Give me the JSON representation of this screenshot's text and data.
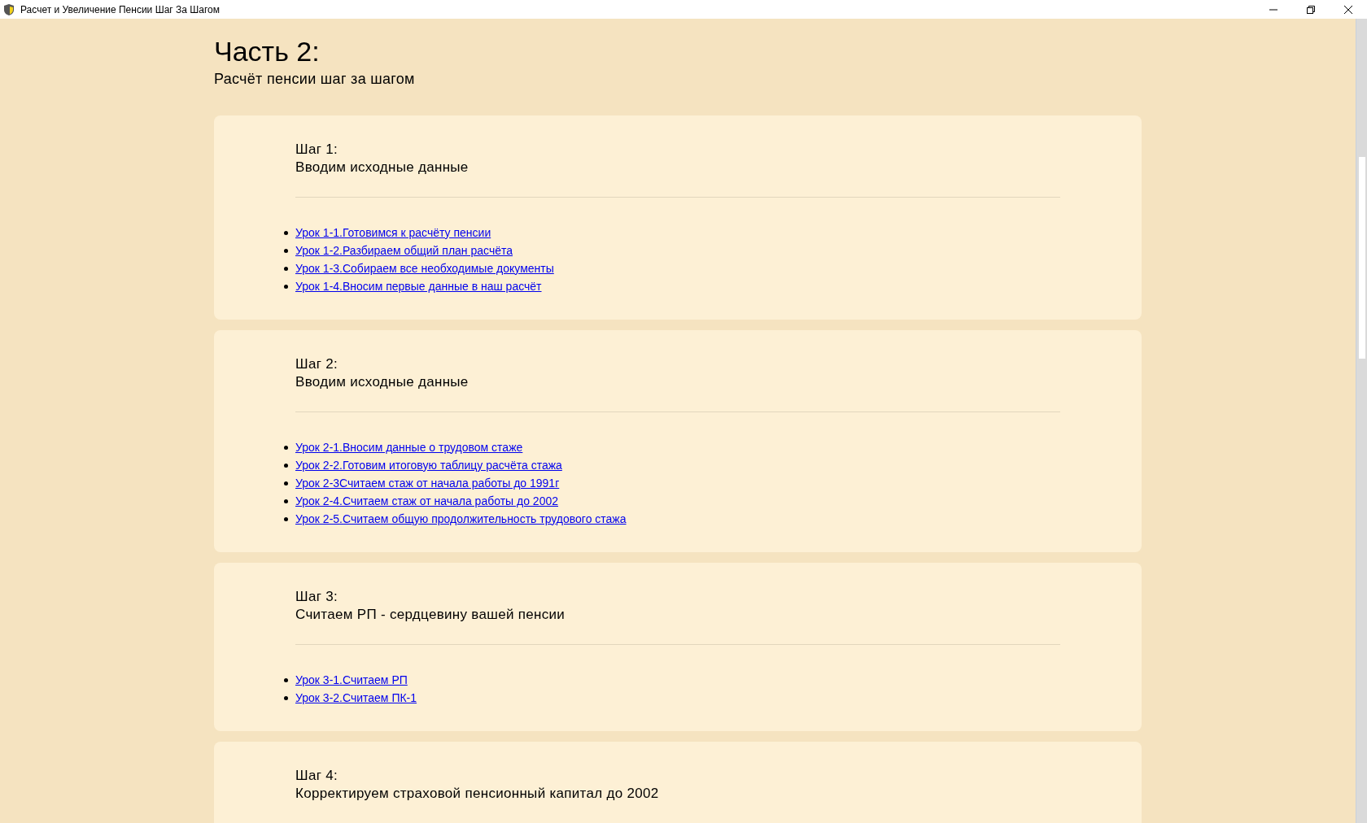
{
  "window": {
    "title": "Расчет и Увеличение Пенсии Шаг За Шагом"
  },
  "part": {
    "heading": "Часть 2:",
    "subtitle": "Расчёт пенсии шаг за шагом"
  },
  "steps": [
    {
      "label": "Шаг 1:",
      "title": "Вводим исходные данные",
      "lessons": [
        "Урок 1-1.Готовимся к расчёту пенсии",
        "Урок 1-2.Разбираем общий план расчёта",
        "Урок 1-3.Собираем все необходимые документы",
        "Урок 1-4.Вносим первые данные в наш расчёт"
      ]
    },
    {
      "label": "Шаг 2:",
      "title": "Вводим исходные данные",
      "lessons": [
        "Урок 2-1.Вносим данные о трудовом стаже",
        "Урок 2-2.Готовим итоговую таблицу расчёта стажа",
        "Урок 2-3Считаем стаж от начала работы до 1991г",
        "Урок 2-4.Считаем стаж от начала работы до 2002",
        "Урок 2-5.Считаем общую продолжительность трудового стажа"
      ]
    },
    {
      "label": "Шаг 3:",
      "title": "Считаем РП - сердцевину вашей пенсии",
      "lessons": [
        "Урок 3-1.Считаем РП",
        "Урок 3-2.Считаем ПК-1"
      ]
    },
    {
      "label": "Шаг 4:",
      "title": "Корректируем страховой пенсионный капитал до 2002"
    }
  ]
}
